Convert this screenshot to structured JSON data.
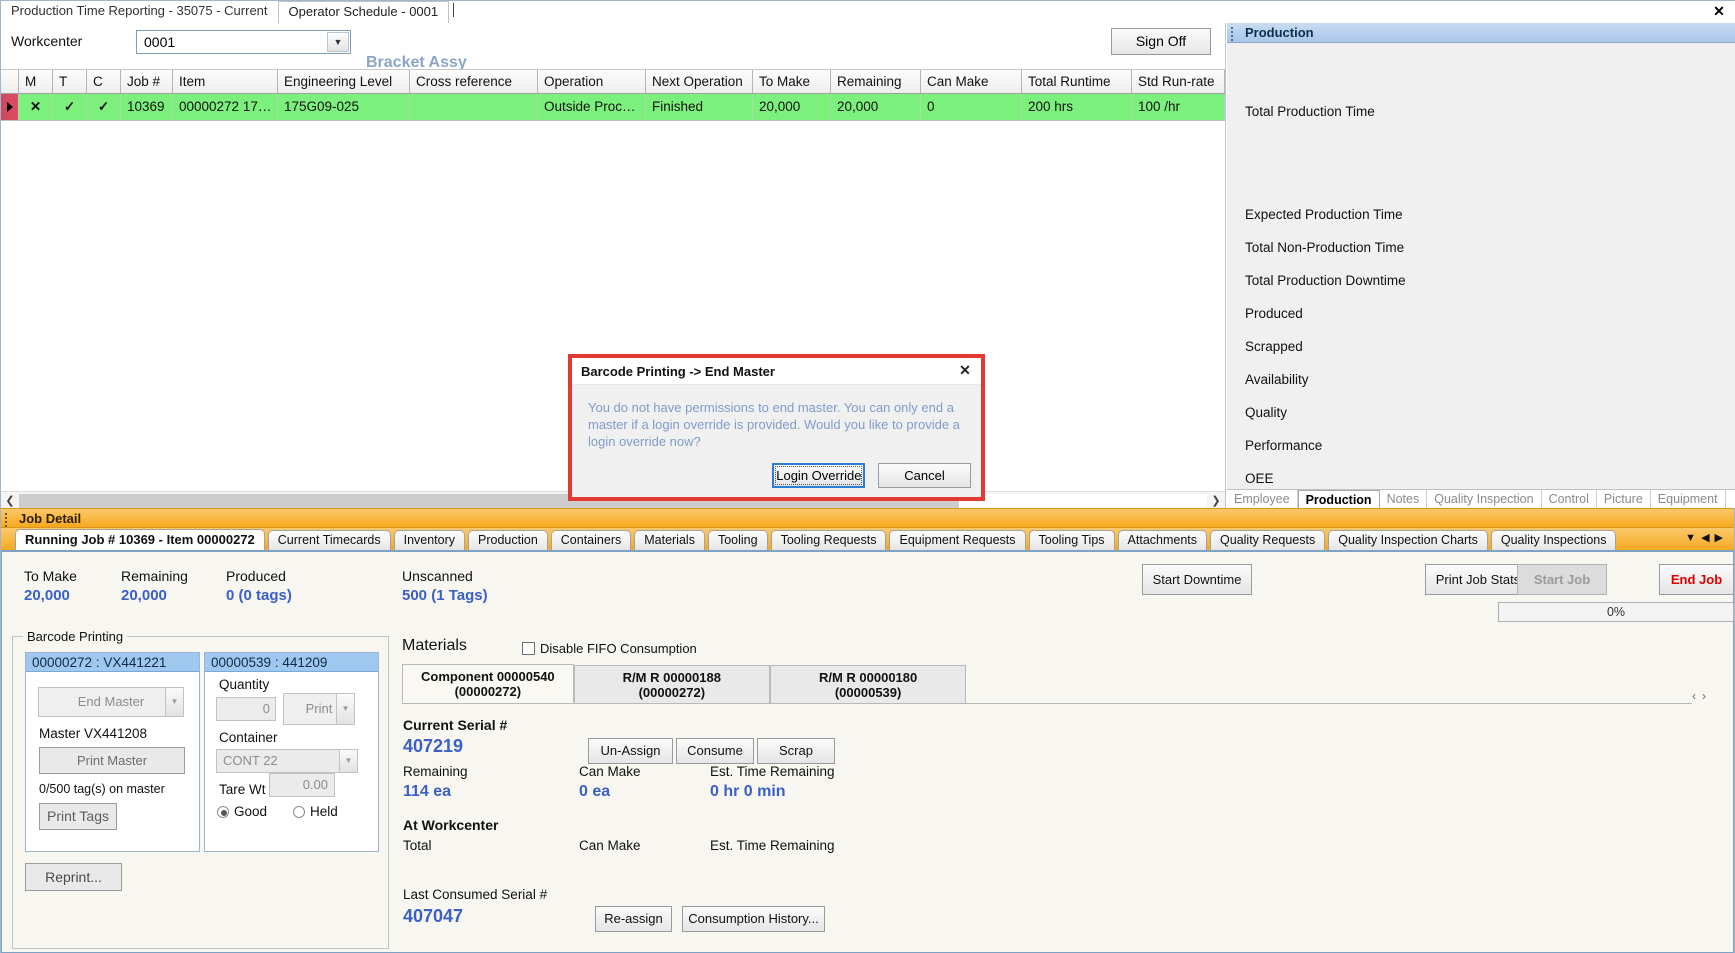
{
  "window": {
    "tabs": [
      {
        "label": "Production Time Reporting - 35075 - Current",
        "active": false
      },
      {
        "label": "Operator Schedule - 0001",
        "active": true
      }
    ],
    "close_icon": "✕"
  },
  "workcenter": {
    "label": "Workcenter",
    "value": "0001",
    "description": "Bracket Assy",
    "sign_off_label": "Sign Off"
  },
  "grid": {
    "columns": [
      "M",
      "T",
      "C",
      "Job #",
      "Item",
      "Engineering Level",
      "Cross reference",
      "Operation",
      "Next Operation",
      "To Make",
      "Remaining",
      "Can Make",
      "Total Runtime",
      "Std Run-rate"
    ],
    "rows": [
      {
        "selected": true,
        "m": "✕",
        "t": "✓",
        "c": "✓",
        "job": "10369",
        "item": "00000272  17…",
        "engineering_level": "175G09-025",
        "cross_reference": "",
        "operation": "Outside  Proc…",
        "next_operation": "Finished",
        "to_make": "20,000",
        "remaining": "20,000",
        "can_make": "0",
        "total_runtime": "200 hrs",
        "std_run_rate": "100 /hr"
      }
    ]
  },
  "production_panel": {
    "title": "Production",
    "metrics": [
      {
        "label": "Total Production Time",
        "value": ""
      },
      {
        "label": "Expected Production Time",
        "value": ""
      },
      {
        "label": "Total Non-Production Time",
        "value": ""
      },
      {
        "label": "Total Production Downtime",
        "value": ""
      },
      {
        "label": "Produced",
        "value": ""
      },
      {
        "label": "Scrapped",
        "value": ""
      },
      {
        "label": "Availability",
        "value": ""
      },
      {
        "label": "Quality",
        "value": ""
      },
      {
        "label": "Performance",
        "value": ""
      },
      {
        "label": "OEE",
        "value": ""
      }
    ],
    "tabs": [
      {
        "label": "Employee",
        "active": false
      },
      {
        "label": "Production",
        "active": true
      },
      {
        "label": "Notes",
        "active": false
      },
      {
        "label": "Quality Inspection",
        "active": false
      },
      {
        "label": "Control",
        "active": false
      },
      {
        "label": "Picture",
        "active": false
      },
      {
        "label": "Equipment",
        "active": false
      }
    ]
  },
  "job_detail": {
    "bar_title": "Job Detail",
    "tabs": [
      {
        "label": "Running Job # 10369 - Item 00000272",
        "active": true
      },
      {
        "label": "Current Timecards",
        "active": false
      },
      {
        "label": "Inventory",
        "active": false
      },
      {
        "label": "Production",
        "active": false
      },
      {
        "label": "Containers",
        "active": false
      },
      {
        "label": "Materials",
        "active": false
      },
      {
        "label": "Tooling",
        "active": false
      },
      {
        "label": "Tooling Requests",
        "active": false
      },
      {
        "label": "Equipment Requests",
        "active": false
      },
      {
        "label": "Tooling Tips",
        "active": false
      },
      {
        "label": "Attachments",
        "active": false
      },
      {
        "label": "Quality Requests",
        "active": false
      },
      {
        "label": "Quality Inspection Charts",
        "active": false
      },
      {
        "label": "Quality Inspections",
        "active": false
      }
    ],
    "summary": [
      {
        "label": "To Make",
        "value": "20,000"
      },
      {
        "label": "Remaining",
        "value": "20,000"
      },
      {
        "label": "Produced",
        "value": "0 (0 tags)"
      },
      {
        "label": "Unscanned",
        "value": "500 (1 Tags)"
      }
    ],
    "actions": {
      "start_downtime": "Start Downtime",
      "print_job_stats": "Print Job Stats",
      "start_job": "Start Job",
      "end_job": "End Job",
      "progress": "0%"
    }
  },
  "barcode_printing": {
    "group_title": "Barcode Printing",
    "left_card": {
      "header": "00000272 : VX441221",
      "end_master_label": "End Master",
      "master_label": "Master VX441208",
      "print_master_label": "Print Master",
      "tags_on_master": "0/500 tag(s) on master",
      "print_tags_label": "Print Tags"
    },
    "right_card": {
      "header": "00000539 : 441209",
      "quantity_label": "Quantity",
      "quantity_value": "0",
      "print_label": "Print",
      "container_label": "Container",
      "container_value": "CONT 22",
      "tare_wt_label": "Tare Wt",
      "tare_wt_value": "0.00",
      "good_label": "Good",
      "held_label": "Held",
      "selected_state": "Good"
    },
    "reprint_label": "Reprint..."
  },
  "materials": {
    "title": "Materials",
    "disable_fifo_label": "Disable FIFO Consumption",
    "disable_fifo_checked": false,
    "tabs": [
      {
        "line1": "Component 00000540",
        "line2": "(00000272)",
        "active": true
      },
      {
        "line1": "R/M R 00000188",
        "line2": "(00000272)",
        "active": false
      },
      {
        "line1": "R/M R 00000180",
        "line2": "(00000539)",
        "active": false
      }
    ],
    "current_serial_label": "Current Serial #",
    "current_serial_value": "407219",
    "remaining_label": "Remaining",
    "remaining_value": "114 ea",
    "can_make_label": "Can Make",
    "can_make_value": "0 ea",
    "est_time_label": "Est. Time Remaining",
    "est_time_value": "0 hr 0 min",
    "un_assign_label": "Un-Assign",
    "consume_label": "Consume",
    "scrap_label": "Scrap",
    "at_workcenter_label": "At Workcenter",
    "total_label": "Total",
    "wc_can_make_label": "Can Make",
    "wc_est_time_label": "Est. Time Remaining",
    "last_consumed_label": "Last Consumed Serial #",
    "last_consumed_value": "407047",
    "reassign_label": "Re-assign",
    "consumption_history_label": "Consumption History...",
    "nav_prev_icon": "‹",
    "nav_next_icon": "›"
  },
  "modal": {
    "title": "Barcode Printing -> End Master",
    "close_icon": "✕",
    "message": "You do not have permissions to end master. You can only end a master if a login override is provided. Would you like to provide a login override now?",
    "primary_label": "Login Override",
    "secondary_label": "Cancel",
    "border_color": "#e23a33"
  }
}
